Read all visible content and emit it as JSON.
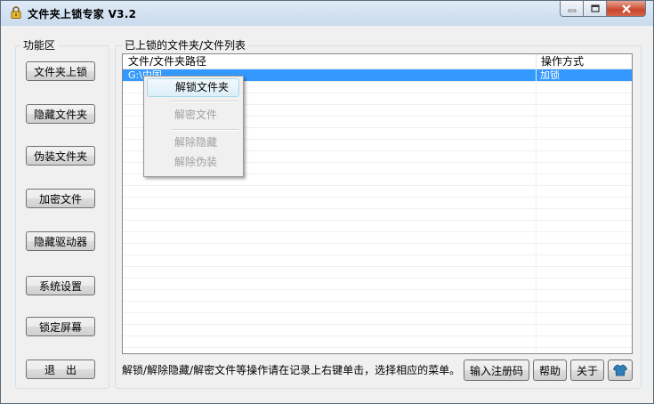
{
  "window": {
    "title": "文件夹上锁专家 V3.2"
  },
  "left_panel": {
    "label": "功能区",
    "buttons": [
      {
        "label": "文件夹上锁"
      },
      {
        "label": "隐藏文件夹"
      },
      {
        "label": "伪装文件夹"
      },
      {
        "label": "加密文件"
      },
      {
        "label": "隐藏驱动器"
      },
      {
        "label": "系统设置"
      },
      {
        "label": "锁定屏幕"
      },
      {
        "label": "退　出"
      }
    ]
  },
  "list_panel": {
    "label": "已上锁的文件夹/文件列表",
    "columns": [
      "文件/文件夹路径",
      "操作方式"
    ],
    "rows": [
      {
        "path": "G:\\中国",
        "method": "加锁",
        "selected": true
      }
    ]
  },
  "context_menu": {
    "items": [
      {
        "label": "解锁文件夹",
        "enabled": true
      },
      {
        "label": "解密文件",
        "enabled": false
      },
      {
        "label": "解除隐藏",
        "enabled": false
      },
      {
        "label": "解除伪装",
        "enabled": false
      }
    ]
  },
  "footer": {
    "hint": "解锁/解除隐藏/解密文件等操作请在记录上右键单击，选择相应的菜单。",
    "register_label": "输入注册码",
    "help_label": "帮助",
    "about_label": "关于",
    "skin_icon": "shirt-icon"
  },
  "colors": {
    "selection": "#3399ff",
    "titlebar": "#c9dbee",
    "close_button": "#c9472d"
  }
}
